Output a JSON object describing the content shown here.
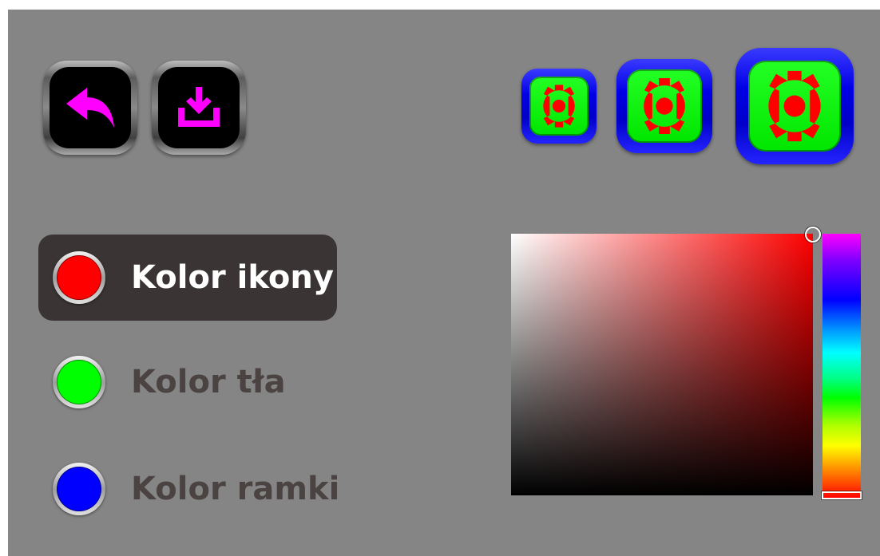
{
  "toolbar": {
    "back_icon": "back-arrow-icon",
    "save_icon": "download-icon",
    "icon_color": "#ff00ff"
  },
  "previews": {
    "icon": "gear-icon",
    "icon_color": "#ff0000",
    "background_color": "#00ff00",
    "frame_color": "#0000ff",
    "sizes": [
      "small",
      "medium",
      "large"
    ]
  },
  "color_options": [
    {
      "label": "Kolor ikony",
      "color": "#ff0000",
      "selected": true
    },
    {
      "label": "Kolor tła",
      "color": "#00ff00",
      "selected": false
    },
    {
      "label": "Kolor ramki",
      "color": "#0000ff",
      "selected": false
    }
  ],
  "picker": {
    "hue": 0,
    "saturation": 1.0,
    "value": 1.0,
    "current_color": "#ff0000"
  }
}
